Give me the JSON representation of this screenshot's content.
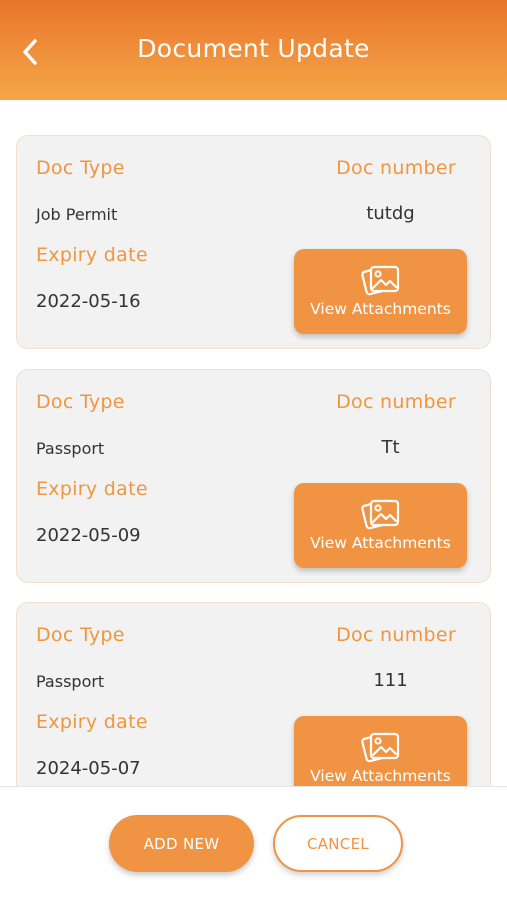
{
  "header": {
    "title": "Document Update",
    "back_icon": "chevron-left-icon"
  },
  "documents": [
    {
      "doc_type_label": "Doc Type",
      "doc_number_label": "Doc number",
      "doc_type": "Job Permit",
      "doc_number": "tutdg",
      "expiry_label": "Expiry date",
      "expiry_date": "2022-05-16",
      "attach_label": "View Attachments"
    },
    {
      "doc_type_label": "Doc Type",
      "doc_number_label": "Doc number",
      "doc_type": "Passport",
      "doc_number": "Tt",
      "expiry_label": "Expiry date",
      "expiry_date": "2022-05-09",
      "attach_label": "View Attachments"
    },
    {
      "doc_type_label": "Doc Type",
      "doc_number_label": "Doc number",
      "doc_type": "Passport",
      "doc_number": "111",
      "expiry_label": "Expiry date",
      "expiry_date": "2024-05-07",
      "attach_label": "View Attachments"
    }
  ],
  "footer": {
    "add_label": "ADD NEW",
    "cancel_label": "CANCEL"
  },
  "colors": {
    "accent": "#f09444",
    "header_top": "#e8752a",
    "header_bottom": "#f4a545",
    "label": "#ee9640",
    "card_bg": "#f2f2f2"
  }
}
